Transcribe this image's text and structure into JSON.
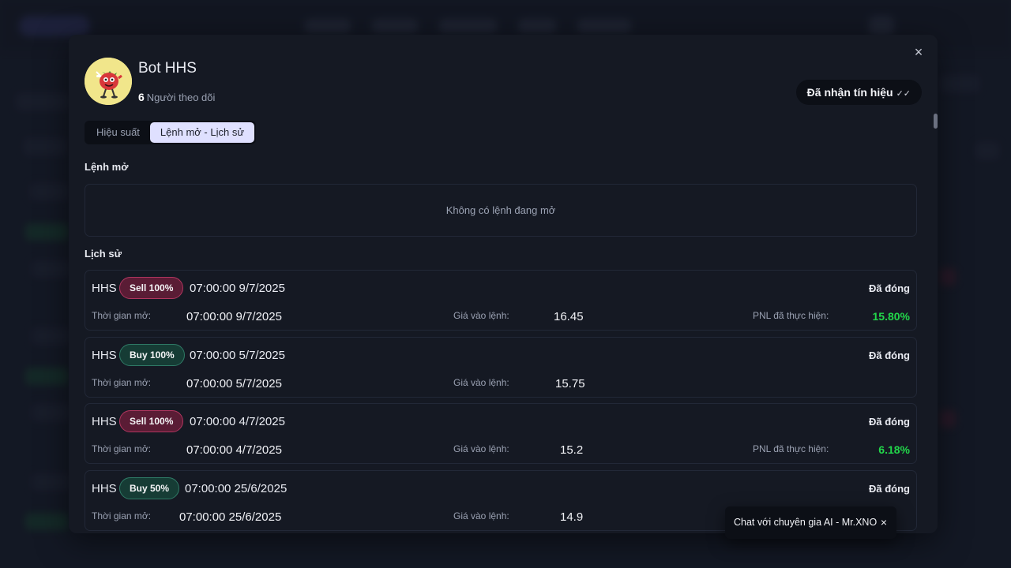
{
  "modal": {
    "close_icon": "×",
    "bot": {
      "name": "Bot HHS",
      "followers_count": "6",
      "followers_label": "Người theo dõi"
    },
    "signal_button": {
      "label": "Đã nhận tín hiệu",
      "icon": "✓✓"
    },
    "tabs": [
      {
        "label": "Hiệu suất",
        "active": false
      },
      {
        "label": "Lệnh mở - Lịch sử",
        "active": true
      }
    ],
    "open_orders": {
      "title": "Lệnh mở",
      "empty_text": "Không có lệnh đang mở"
    },
    "history": {
      "title": "Lịch sử",
      "labels": {
        "open_time": "Thời gian mở:",
        "entry_price": "Giá vào lệnh:",
        "pnl": "PNL đã thực hiện:"
      },
      "items": [
        {
          "symbol": "HHS",
          "side": "Sell 100%",
          "time": "07:00:00 9/7/2025",
          "status": "Đã đóng",
          "open_time": "07:00:00 9/7/2025",
          "entry_price": "16.45",
          "pnl": "15.80%"
        },
        {
          "symbol": "HHS",
          "side": "Buy 100%",
          "time": "07:00:00 5/7/2025",
          "status": "Đã đóng",
          "open_time": "07:00:00 5/7/2025",
          "entry_price": "15.75",
          "pnl": ""
        },
        {
          "symbol": "HHS",
          "side": "Sell 100%",
          "time": "07:00:00 4/7/2025",
          "status": "Đã đóng",
          "open_time": "07:00:00 4/7/2025",
          "entry_price": "15.2",
          "pnl": "6.18%"
        },
        {
          "symbol": "HHS",
          "side": "Buy 50%",
          "time": "07:00:00 25/6/2025",
          "status": "Đã đóng",
          "open_time": "07:00:00 25/6/2025",
          "entry_price": "14.9",
          "pnl": ""
        }
      ]
    }
  },
  "chat_popup": {
    "label": "Chat với chuyên gia AI - Mr.XNO",
    "close_icon": "×"
  },
  "colors": {
    "pnl_positive": "#22d64a",
    "sell": "#b0365f",
    "buy": "#2f7a66",
    "tab_active": "#dfe0ff"
  }
}
